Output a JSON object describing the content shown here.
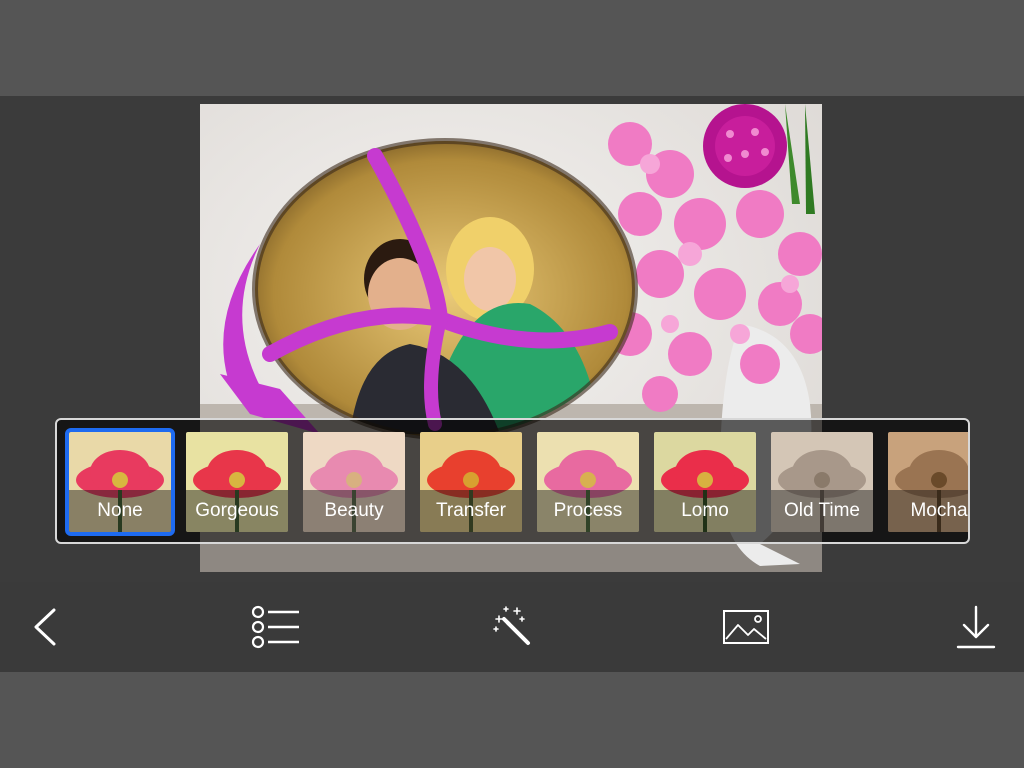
{
  "filters": [
    {
      "label": "None",
      "selected": true
    },
    {
      "label": "Gorgeous"
    },
    {
      "label": "Beauty"
    },
    {
      "label": "Transfer"
    },
    {
      "label": "Process"
    },
    {
      "label": "Lomo"
    },
    {
      "label": "Old Time"
    },
    {
      "label": "Mocha"
    }
  ],
  "toolbar": {
    "icons": [
      "back-icon",
      "list-icon",
      "magic-wand-icon",
      "image-icon",
      "download-icon"
    ]
  },
  "colors": {
    "accent": "#1e6bf0",
    "frame": "#c63ad0"
  }
}
